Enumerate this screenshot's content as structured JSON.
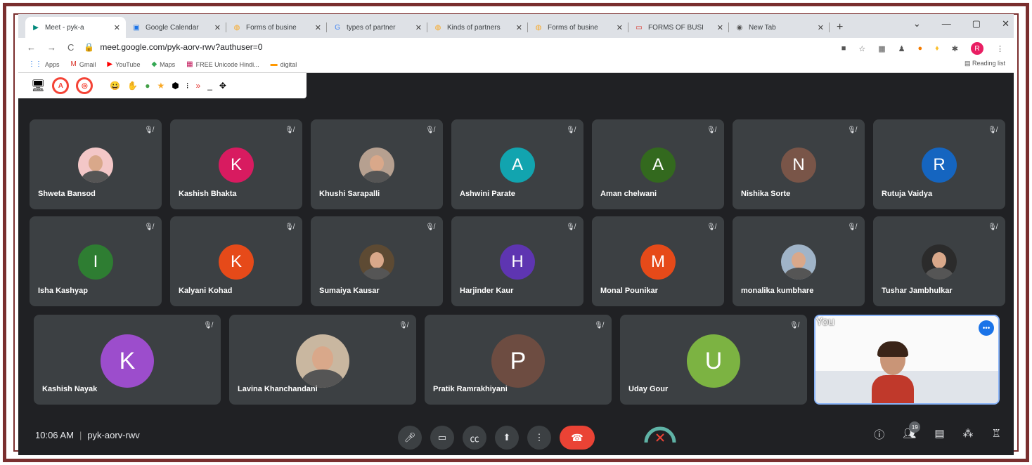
{
  "tabs": [
    {
      "title": "Meet - pyk-a",
      "icon": "meet-icon",
      "active": true
    },
    {
      "title": "Google Calendar",
      "icon": "calendar-icon"
    },
    {
      "title": "Forms of busine",
      "icon": "page-icon"
    },
    {
      "title": "types of partner",
      "icon": "google-icon"
    },
    {
      "title": "Kinds of partners",
      "icon": "page-icon"
    },
    {
      "title": "Forms of busine",
      "icon": "page-icon"
    },
    {
      "title": "FORMS OF BUSI",
      "icon": "slides-icon"
    },
    {
      "title": "New Tab",
      "icon": "chrome-icon"
    }
  ],
  "address": {
    "url": "meet.google.com/pyk-aorv-rwv?authuser=0",
    "profile_initial": "R"
  },
  "bookmarks": [
    {
      "label": "Apps",
      "icon": "apps-icon"
    },
    {
      "label": "Gmail",
      "icon": "gmail-icon"
    },
    {
      "label": "YouTube",
      "icon": "youtube-icon"
    },
    {
      "label": "Maps",
      "icon": "maps-icon"
    },
    {
      "label": "FREE Unicode Hindi...",
      "icon": "hindi-icon"
    },
    {
      "label": "digital",
      "icon": "flag-icon"
    }
  ],
  "reading_list": "Reading list",
  "participants": [
    {
      "name": "Shweta Bansod",
      "photo": true,
      "color": "#f3c7c7"
    },
    {
      "name": "Kashish Bhakta",
      "initial": "K",
      "color": "#d81b60"
    },
    {
      "name": "Khushi Sarapalli",
      "photo": true,
      "color": "#b6a090"
    },
    {
      "name": "Ashwini Parate",
      "initial": "A",
      "color": "#12a4af"
    },
    {
      "name": "Aman chelwani",
      "initial": "A",
      "color": "#33691e"
    },
    {
      "name": "Nishika Sorte",
      "initial": "N",
      "color": "#795548"
    },
    {
      "name": "Rutuja Vaidya",
      "initial": "R",
      "color": "#1565c0"
    },
    {
      "name": "Isha Kashyap",
      "initial": "I",
      "color": "#2e7d32"
    },
    {
      "name": "Kalyani Kohad",
      "initial": "K",
      "color": "#e64a19"
    },
    {
      "name": "Sumaiya Kausar",
      "photo": true,
      "color": "#5d4a33"
    },
    {
      "name": "Harjinder Kaur",
      "initial": "H",
      "color": "#5e35b1"
    },
    {
      "name": "Monal Pounikar",
      "initial": "M",
      "color": "#e64a19"
    },
    {
      "name": "monalika kumbhare",
      "photo": true,
      "color": "#a0b4c8"
    },
    {
      "name": "Tushar Jambhulkar",
      "photo": true,
      "color": "#2b2b2b"
    },
    {
      "name": "Kashish Nayak",
      "initial": "K",
      "color": "#9c4dcc"
    },
    {
      "name": "Lavina Khanchandani",
      "photo": true,
      "color": "#c9b7a0"
    },
    {
      "name": "Pratik Ramrakhiyani",
      "initial": "P",
      "color": "#6d4c41"
    },
    {
      "name": "Uday Gour",
      "initial": "U",
      "color": "#7cb342"
    }
  ],
  "self_tile": {
    "name": "You"
  },
  "meeting": {
    "time": "10:06 AM",
    "code": "pyk-aorv-rwv",
    "participant_count": "19"
  }
}
